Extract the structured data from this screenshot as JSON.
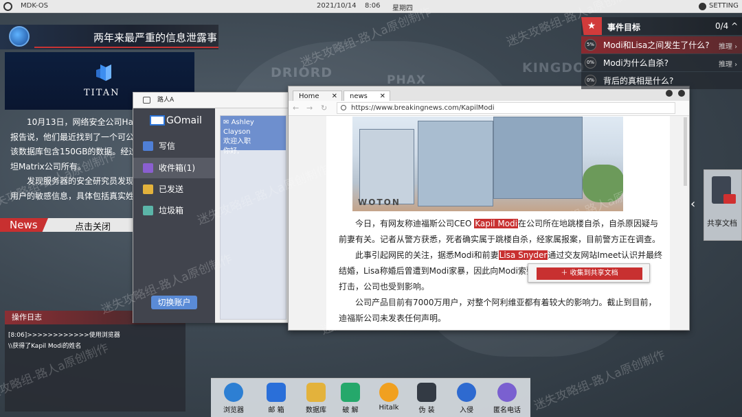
{
  "topbar": {
    "os_name": "MDK-OS",
    "date": "2021/10/14",
    "time": "8:06",
    "weekday": "星期四",
    "settings": "SETTING"
  },
  "map_words": [
    "DRIORD",
    "PHAX",
    "KINGDO"
  ],
  "news": {
    "headline": "两年来最严重的信息泄露事件",
    "image_brand": "Titan",
    "paragraphs": [
      "10月13日，网络安全公司Hacke",
      "报告说，他们最近找到了一个可公开",
      "该数据库包含150GB的数据。经过研",
      "坦Matrix公司所有。",
      "发现服务器的安全研究员发现数",
      "用户的敏感信息，具体包括真实姓名"
    ],
    "tag": "News",
    "close_label": "点击关闭"
  },
  "oplog": {
    "title": "操作日志",
    "lines": [
      "[8:06]>>>>>>>>>>>>使用浏览器",
      "\\\\获得了Kapil Modi的姓名"
    ]
  },
  "mail": {
    "window_title": "路人A",
    "brand": "GOmail",
    "nav": [
      {
        "label": "写信",
        "color": "#4f7fd6"
      },
      {
        "label": "收件箱(1)",
        "color": "#8a5fd0"
      },
      {
        "label": "已发送",
        "color": "#e3b23c"
      },
      {
        "label": "垃圾箱",
        "color": "#5bb5a8"
      }
    ],
    "switch_account": "切换账户",
    "message": {
      "sender": "Ashley Clayson",
      "subject": "欢迎入职",
      "preview": "你好,"
    }
  },
  "browser": {
    "tabs": [
      "Home",
      "news"
    ],
    "url": "https://www.breakingnews.com/KapilModi",
    "sign_text": "WOTON",
    "article": [
      {
        "indent": true,
        "parts": [
          "今日，有网友称迪福斯公司CEO ",
          "Kapil Modi",
          "在公司所在地跳楼自杀，自杀原因疑与"
        ]
      },
      {
        "indent": false,
        "parts": [
          "前妻有关。记者从警方获悉，死者确实属于跳楼自杀，经家属报案，目前警方正在调查。"
        ]
      },
      {
        "indent": true,
        "parts": [
          "此事引起网民的关注，据悉Modi和前妻",
          "Lisa Snyder",
          "通过交友网站Imeet认识并最终"
        ]
      },
      {
        "indent": false,
        "parts": [
          "结婚，Lisa称婚后曾遭到Modi家暴，因此向Modi索要100"
        ]
      },
      {
        "indent": false,
        "parts": [
          "打击，公司也受到影响。"
        ]
      },
      {
        "indent": true,
        "parts": [
          "公司产品目前有7000万用户，对整个阿利维亚都有着较大的影响力。截止到目前，"
        ]
      },
      {
        "indent": false,
        "parts": [
          "迪福斯公司未发表任何声明。"
        ]
      }
    ],
    "collect_button": "收集到共享文档"
  },
  "events": {
    "title": "事件目标",
    "count": "0/4",
    "items": [
      {
        "pct": "5%",
        "question": "Modi和Lisa之间发生了什么?",
        "hint": "推理"
      },
      {
        "pct": "0%",
        "question": "Modi为什么自杀?",
        "hint": "推理"
      },
      {
        "pct": "0%",
        "question": "背后的真相是什么?",
        "hint": ""
      }
    ]
  },
  "share": {
    "label": "共享文档"
  },
  "dock": [
    {
      "label": "浏览器",
      "color": "#2d7fd3"
    },
    {
      "label": "邮 箱",
      "color": "#2a6fd9"
    },
    {
      "label": "数据库",
      "color": "#e3b23c"
    },
    {
      "label": "破 解",
      "color": "#25a86b"
    },
    {
      "label": "Hitalk",
      "color": "#f0a020"
    },
    {
      "label": "伪 装",
      "color": "#333a44"
    },
    {
      "label": "入侵",
      "color": "#2e6ad0"
    },
    {
      "label": "匿名电话",
      "color": "#7a60d0"
    }
  ],
  "watermark": "迷失攻略组-路人a原创制作"
}
